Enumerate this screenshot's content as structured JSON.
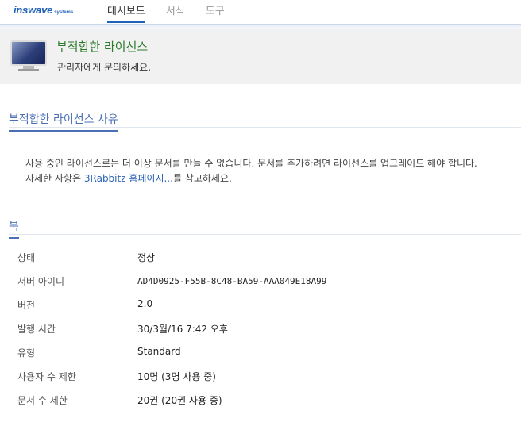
{
  "topbar": {
    "logo_main": "inswave",
    "logo_sub": "systems",
    "tabs": [
      {
        "label": "대시보드",
        "active": true
      },
      {
        "label": "서식",
        "active": false
      },
      {
        "label": "도구",
        "active": false
      }
    ]
  },
  "header": {
    "icon": "monitor-icon",
    "title": "부적합한 라이선스",
    "subtitle": "관리자에게 문의하세요."
  },
  "reason_section": {
    "title": "부적합한 라이선스 사유",
    "line1": "사용 중인 라이선스로는 더 이상 문서를 만들 수 없습니다. 문서를 추가하려면 라이선스를 업그레이드 해야 합니다.",
    "line2_prefix": "자세한 사항은 ",
    "line2_link": "3Rabbitz 홈페이지...",
    "line2_suffix": "를 참고하세요."
  },
  "book_section": {
    "title": "북",
    "rows": [
      {
        "label": "상태",
        "value": "정상"
      },
      {
        "label": "서버 아이디",
        "value": "AD4D0925-F55B-8C48-BA59-AAA049E18A99"
      },
      {
        "label": "버전",
        "value": "2.0"
      },
      {
        "label": "발행 시간",
        "value": "30/3월/16 7:42 오후"
      },
      {
        "label": "유형",
        "value": "Standard"
      },
      {
        "label": "사용자 수 제한",
        "value": "10명 (3명 사용 중)"
      },
      {
        "label": "문서 수 제한",
        "value": "20권 (20권 사용 중)"
      }
    ]
  },
  "colors": {
    "accent": "#1f62b8",
    "section_title": "#4a6fb5",
    "header_title": "#2b7a2b",
    "link": "#2b63b3"
  }
}
